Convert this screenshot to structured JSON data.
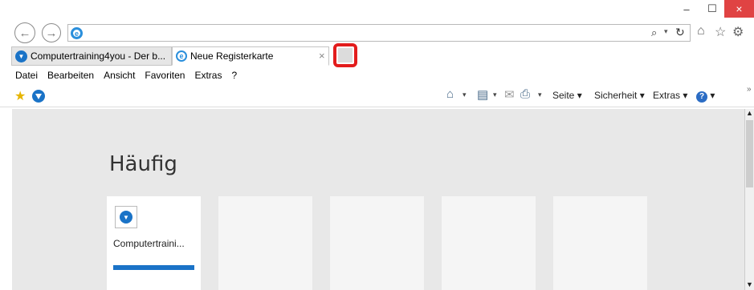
{
  "window": {
    "minimize": "–",
    "maximize": "☐",
    "close": "×"
  },
  "nav": {
    "back": "←",
    "forward": "→",
    "address_value": "",
    "search_glyph": "⌕",
    "dropdown_glyph": "▾",
    "refresh_glyph": "↻",
    "home_glyph": "⌂",
    "favorites_glyph": "☆",
    "settings_glyph": "⚙"
  },
  "tabs": [
    {
      "label": "Computertraining4you - Der b...",
      "active": false
    },
    {
      "label": "Neue Registerkarte",
      "active": true,
      "close": "×"
    }
  ],
  "menu": [
    "Datei",
    "Bearbeiten",
    "Ansicht",
    "Favoriten",
    "Extras",
    "?"
  ],
  "commandbar": {
    "fav_star": "★",
    "home": "⌂",
    "feeds": "▤",
    "mail": "✉",
    "print": "⎙",
    "page_label": "Seite",
    "security_label": "Sicherheit",
    "tools_label": "Extras",
    "help": "?",
    "drop": "▾",
    "more": "»"
  },
  "newtab_page": {
    "heading": "Häufig",
    "tiles": [
      {
        "label": "Computertraini...",
        "logo": "▼"
      },
      {
        "label": ""
      },
      {
        "label": ""
      },
      {
        "label": ""
      },
      {
        "label": ""
      }
    ]
  },
  "scrollbar": {
    "up": "▲",
    "down": "▼"
  }
}
